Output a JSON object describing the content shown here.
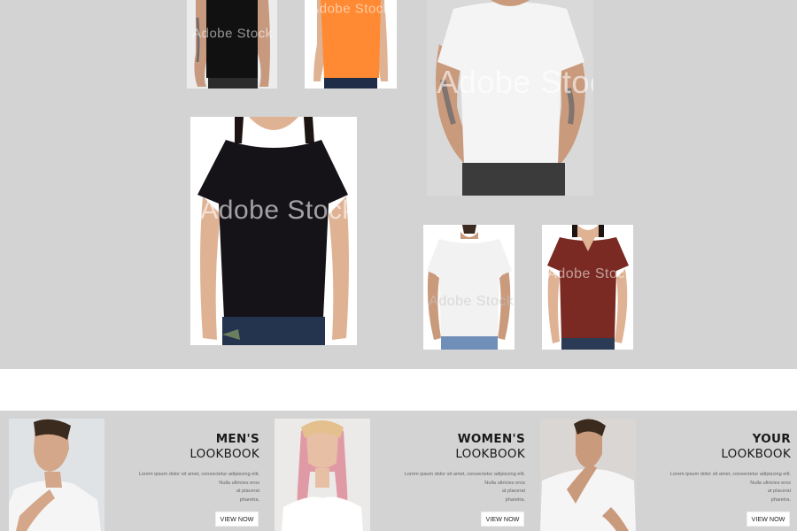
{
  "gallery": {
    "watermark": "Adobe Stock",
    "photos": [
      {
        "alt": "Man in black t-shirt",
        "shirt_color": "#111111"
      },
      {
        "alt": "Woman in orange t-shirt",
        "shirt_color": "#ff8a33"
      },
      {
        "alt": "Man in white t-shirt",
        "shirt_color": "#f4f4f4"
      },
      {
        "alt": "Woman in black t-shirt",
        "shirt_color": "#151318"
      },
      {
        "alt": "Man in white t-shirt",
        "shirt_color": "#f2f2f2"
      },
      {
        "alt": "Woman in maroon t-shirt",
        "shirt_color": "#7a2a22"
      }
    ]
  },
  "lookbook": {
    "cards": [
      {
        "title_bold": "MEN'S",
        "title_normal": "LOOKBOOK",
        "desc_lines": [
          "Lorem ipsum dolor sit amet, consectetur adipiscing elit.",
          "Nulla ultricies eros",
          "at placerat",
          "pharetra."
        ],
        "button": "VIEW NOW"
      },
      {
        "title_bold": "WOMEN'S",
        "title_normal": "LOOKBOOK",
        "desc_lines": [
          "Lorem ipsum dolor sit amet, consectetur adipiscing elit.",
          "Nulla ultricies eros",
          "at placerat",
          "pharetra."
        ],
        "button": "VIEW NOW"
      },
      {
        "title_bold": "YOUR",
        "title_normal": "LOOKBOOK",
        "desc_lines": [
          "Lorem ipsum dolor sit amet, consectetur adipiscing elit.",
          "Nulla ultricies eros",
          "at placerat",
          "pharetra."
        ],
        "button": "VIEW NOW"
      }
    ]
  },
  "colors": {
    "gallery_bg": "#d3d3d3",
    "skin": "#e0b294",
    "jeans": "#2c3e5c"
  }
}
